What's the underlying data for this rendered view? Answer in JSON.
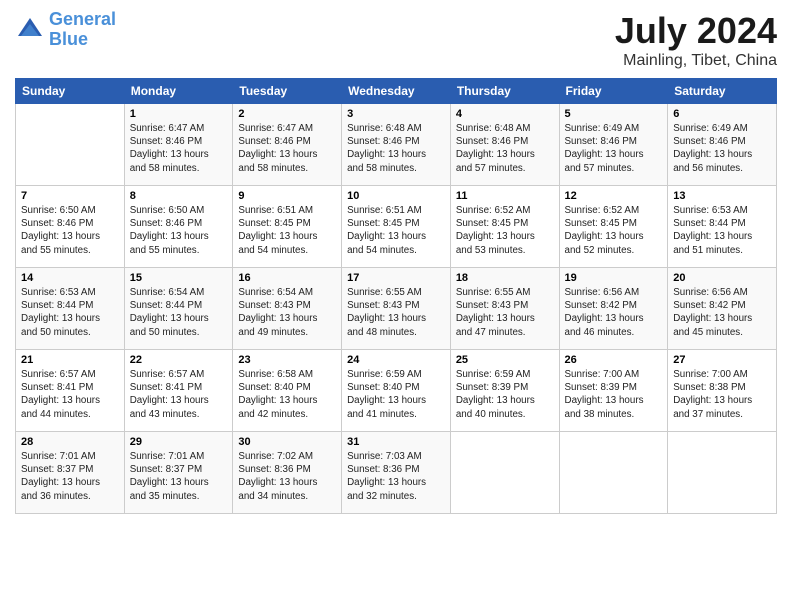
{
  "logo": {
    "line1": "General",
    "line2": "Blue"
  },
  "title": "July 2024",
  "subtitle": "Mainling, Tibet, China",
  "headers": [
    "Sunday",
    "Monday",
    "Tuesday",
    "Wednesday",
    "Thursday",
    "Friday",
    "Saturday"
  ],
  "weeks": [
    [
      {
        "num": "",
        "info": ""
      },
      {
        "num": "1",
        "info": "Sunrise: 6:47 AM\nSunset: 8:46 PM\nDaylight: 13 hours\nand 58 minutes."
      },
      {
        "num": "2",
        "info": "Sunrise: 6:47 AM\nSunset: 8:46 PM\nDaylight: 13 hours\nand 58 minutes."
      },
      {
        "num": "3",
        "info": "Sunrise: 6:48 AM\nSunset: 8:46 PM\nDaylight: 13 hours\nand 58 minutes."
      },
      {
        "num": "4",
        "info": "Sunrise: 6:48 AM\nSunset: 8:46 PM\nDaylight: 13 hours\nand 57 minutes."
      },
      {
        "num": "5",
        "info": "Sunrise: 6:49 AM\nSunset: 8:46 PM\nDaylight: 13 hours\nand 57 minutes."
      },
      {
        "num": "6",
        "info": "Sunrise: 6:49 AM\nSunset: 8:46 PM\nDaylight: 13 hours\nand 56 minutes."
      }
    ],
    [
      {
        "num": "7",
        "info": "Sunrise: 6:50 AM\nSunset: 8:46 PM\nDaylight: 13 hours\nand 55 minutes."
      },
      {
        "num": "8",
        "info": "Sunrise: 6:50 AM\nSunset: 8:46 PM\nDaylight: 13 hours\nand 55 minutes."
      },
      {
        "num": "9",
        "info": "Sunrise: 6:51 AM\nSunset: 8:45 PM\nDaylight: 13 hours\nand 54 minutes."
      },
      {
        "num": "10",
        "info": "Sunrise: 6:51 AM\nSunset: 8:45 PM\nDaylight: 13 hours\nand 54 minutes."
      },
      {
        "num": "11",
        "info": "Sunrise: 6:52 AM\nSunset: 8:45 PM\nDaylight: 13 hours\nand 53 minutes."
      },
      {
        "num": "12",
        "info": "Sunrise: 6:52 AM\nSunset: 8:45 PM\nDaylight: 13 hours\nand 52 minutes."
      },
      {
        "num": "13",
        "info": "Sunrise: 6:53 AM\nSunset: 8:44 PM\nDaylight: 13 hours\nand 51 minutes."
      }
    ],
    [
      {
        "num": "14",
        "info": "Sunrise: 6:53 AM\nSunset: 8:44 PM\nDaylight: 13 hours\nand 50 minutes."
      },
      {
        "num": "15",
        "info": "Sunrise: 6:54 AM\nSunset: 8:44 PM\nDaylight: 13 hours\nand 50 minutes."
      },
      {
        "num": "16",
        "info": "Sunrise: 6:54 AM\nSunset: 8:43 PM\nDaylight: 13 hours\nand 49 minutes."
      },
      {
        "num": "17",
        "info": "Sunrise: 6:55 AM\nSunset: 8:43 PM\nDaylight: 13 hours\nand 48 minutes."
      },
      {
        "num": "18",
        "info": "Sunrise: 6:55 AM\nSunset: 8:43 PM\nDaylight: 13 hours\nand 47 minutes."
      },
      {
        "num": "19",
        "info": "Sunrise: 6:56 AM\nSunset: 8:42 PM\nDaylight: 13 hours\nand 46 minutes."
      },
      {
        "num": "20",
        "info": "Sunrise: 6:56 AM\nSunset: 8:42 PM\nDaylight: 13 hours\nand 45 minutes."
      }
    ],
    [
      {
        "num": "21",
        "info": "Sunrise: 6:57 AM\nSunset: 8:41 PM\nDaylight: 13 hours\nand 44 minutes."
      },
      {
        "num": "22",
        "info": "Sunrise: 6:57 AM\nSunset: 8:41 PM\nDaylight: 13 hours\nand 43 minutes."
      },
      {
        "num": "23",
        "info": "Sunrise: 6:58 AM\nSunset: 8:40 PM\nDaylight: 13 hours\nand 42 minutes."
      },
      {
        "num": "24",
        "info": "Sunrise: 6:59 AM\nSunset: 8:40 PM\nDaylight: 13 hours\nand 41 minutes."
      },
      {
        "num": "25",
        "info": "Sunrise: 6:59 AM\nSunset: 8:39 PM\nDaylight: 13 hours\nand 40 minutes."
      },
      {
        "num": "26",
        "info": "Sunrise: 7:00 AM\nSunset: 8:39 PM\nDaylight: 13 hours\nand 38 minutes."
      },
      {
        "num": "27",
        "info": "Sunrise: 7:00 AM\nSunset: 8:38 PM\nDaylight: 13 hours\nand 37 minutes."
      }
    ],
    [
      {
        "num": "28",
        "info": "Sunrise: 7:01 AM\nSunset: 8:37 PM\nDaylight: 13 hours\nand 36 minutes."
      },
      {
        "num": "29",
        "info": "Sunrise: 7:01 AM\nSunset: 8:37 PM\nDaylight: 13 hours\nand 35 minutes."
      },
      {
        "num": "30",
        "info": "Sunrise: 7:02 AM\nSunset: 8:36 PM\nDaylight: 13 hours\nand 34 minutes."
      },
      {
        "num": "31",
        "info": "Sunrise: 7:03 AM\nSunset: 8:36 PM\nDaylight: 13 hours\nand 32 minutes."
      },
      {
        "num": "",
        "info": ""
      },
      {
        "num": "",
        "info": ""
      },
      {
        "num": "",
        "info": ""
      }
    ]
  ]
}
